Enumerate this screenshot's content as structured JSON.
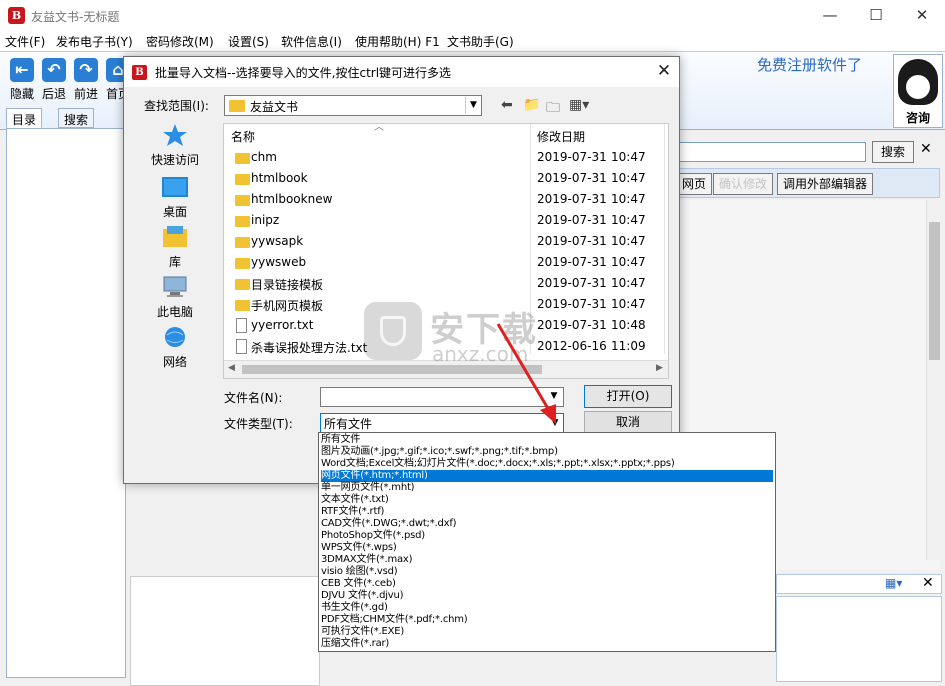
{
  "app": {
    "title": "友益文书-无标题",
    "window_controls": [
      "—",
      "☐",
      "✕"
    ]
  },
  "menu": [
    "文件(F)",
    "发布电子书(Y)",
    "密码修改(M)",
    "设置(S)",
    "软件信息(I)",
    "使用帮助(H) F1",
    "文书助手(G)"
  ],
  "toolbar": {
    "buttons": [
      "隐藏",
      "后退",
      "前进",
      "首页"
    ],
    "free_register": "免费注册软件了",
    "qq_label": "咨询"
  },
  "left_tabs": [
    "目录",
    "搜索"
  ],
  "right_panel": {
    "search_button": "搜索",
    "buttons": [
      "网页",
      "确认修改",
      "调用外部编辑器"
    ]
  },
  "dialog": {
    "title": "批量导入文档--选择要导入的文件,按住ctrl键可进行多选",
    "lookin_label": "查找范围(I):",
    "lookin_value": "友益文书",
    "places": [
      "快速访问",
      "桌面",
      "库",
      "此电脑",
      "网络"
    ],
    "columns": {
      "name": "名称",
      "date": "修改日期"
    },
    "files": [
      {
        "name": "chm",
        "date": "2019-07-31",
        "time": "10:47",
        "type": "folder"
      },
      {
        "name": "htmlbook",
        "date": "2019-07-31",
        "time": "10:47",
        "type": "folder"
      },
      {
        "name": "htmlbooknew",
        "date": "2019-07-31",
        "time": "10:47",
        "type": "folder"
      },
      {
        "name": "inipz",
        "date": "2019-07-31",
        "time": "10:47",
        "type": "folder"
      },
      {
        "name": "yywsapk",
        "date": "2019-07-31",
        "time": "10:47",
        "type": "folder"
      },
      {
        "name": "yywsweb",
        "date": "2019-07-31",
        "time": "10:47",
        "type": "folder"
      },
      {
        "name": "目录链接模板",
        "date": "2019-07-31",
        "time": "10:47",
        "type": "folder"
      },
      {
        "name": "手机网页模板",
        "date": "2019-07-31",
        "time": "10:47",
        "type": "folder"
      },
      {
        "name": "yyerror.txt",
        "date": "2019-07-31",
        "time": "10:48",
        "type": "file"
      },
      {
        "name": "杀毒误报处理方法.txt",
        "date": "2012-06-16",
        "time": "11:09",
        "type": "file"
      }
    ],
    "filename_label": "文件名(N):",
    "filename_value": "",
    "filetype_label": "文件类型(T):",
    "filetype_value": "所有文件",
    "open_button": "打开(O)",
    "cancel_button": "取消"
  },
  "filetype_options": [
    "所有文件",
    "图片及动画(*.jpg;*.gif;*.ico;*.swf;*.png;*.tif;*.bmp)",
    "Word文档;Excel文档;幻灯片文件(*.doc;*.docx;*.xls;*.ppt;*.xlsx;*.pptx;*.pps)",
    "网页文件(*.htm;*.html)",
    "单一网页文件(*.mht)",
    "文本文件(*.txt)",
    "RTF文件(*.rtf)",
    "CAD文件(*.DWG;*.dwt;*.dxf)",
    "PhotoShop文件(*.psd)",
    "WPS文件(*.wps)",
    "3DMAX文件(*.max)",
    "visio 绘图(*.vsd)",
    "CEB 文件(*.ceb)",
    "DJVU 文件(*.djvu)",
    "书生文件(*.gd)",
    "PDF文档;CHM文件(*.pdf;*.chm)",
    "可执行文件(*.EXE)",
    "压缩文件(*.rar)"
  ],
  "filetype_selected_index": 3,
  "watermark": {
    "text": "安下载",
    "sub": "anxz.com"
  },
  "colors": {
    "accent": "#0078d7",
    "brand_red": "#c8161d",
    "folder": "#f1c232",
    "arrow": "#e02020"
  }
}
